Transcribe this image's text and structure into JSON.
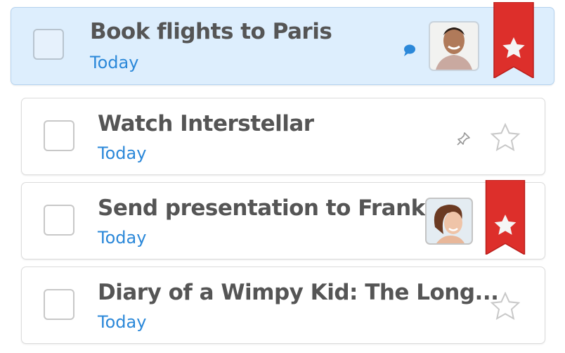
{
  "tasks": [
    {
      "title": "Book flights to Paris",
      "due": "Today",
      "selected": true,
      "starred": true,
      "has_comment": true,
      "assignee": "man-avatar"
    },
    {
      "title": "Watch Interstellar",
      "due": "Today",
      "starred": false,
      "pinned": true
    },
    {
      "title": "Send presentation to Frank",
      "due": "Today",
      "starred": true,
      "assignee": "woman-avatar"
    },
    {
      "title": "Diary of a Wimpy Kid: The Long...",
      "due": "Today",
      "starred": false
    }
  ],
  "colors": {
    "accent": "#2b88d9",
    "ribbon": "#dd2f2b",
    "selected_bg": "#ddeefd"
  }
}
